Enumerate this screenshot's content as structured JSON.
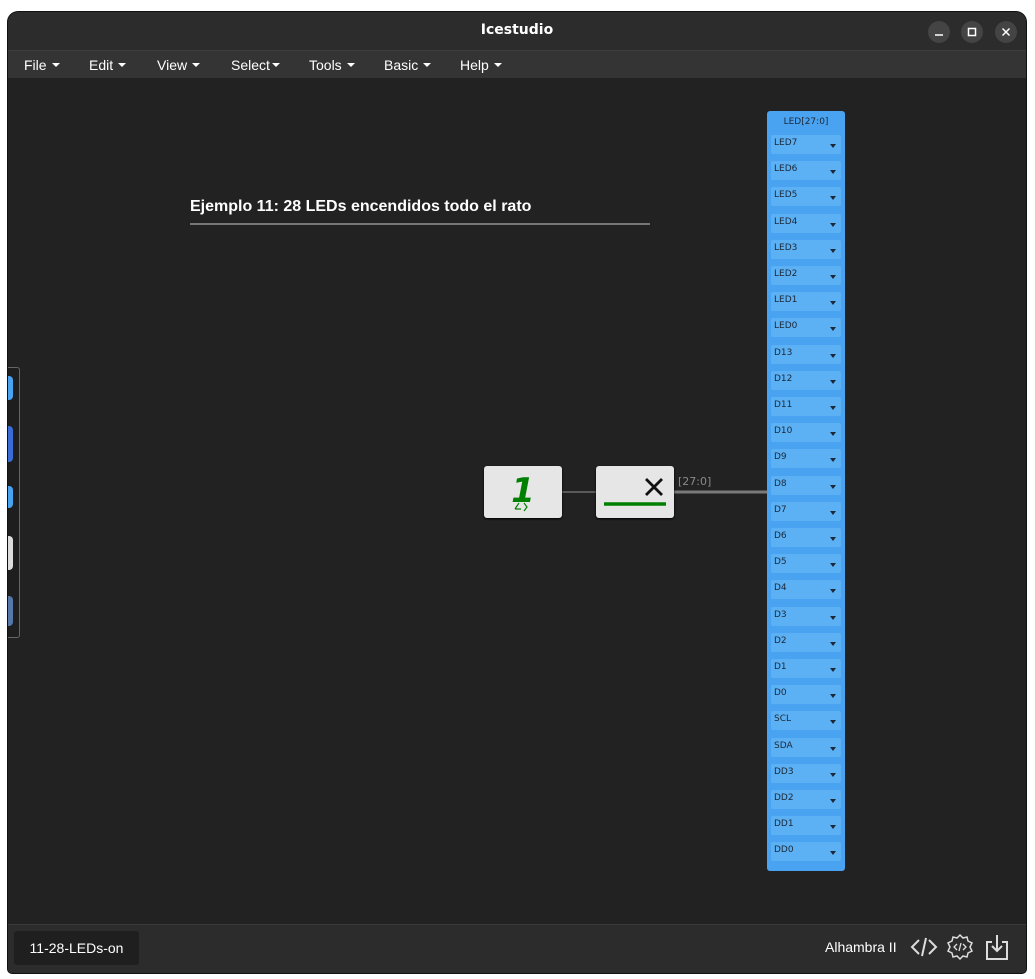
{
  "window": {
    "title": "Icestudio",
    "minimize_icon": "minimize-icon",
    "maximize_icon": "maximize-icon",
    "close_icon": "close-icon"
  },
  "menu": {
    "file": "File",
    "edit": "Edit",
    "view": "View",
    "select": "Select",
    "tools": "Tools",
    "basic": "Basic",
    "help": "Help"
  },
  "canvas": {
    "info_title": "Ejemplo 11: 28 LEDs encendidos todo el rato",
    "constant_value": "1",
    "bus_label": "[27:0]",
    "output": {
      "name": "LED[27:0]",
      "pins": [
        "LED7",
        "LED6",
        "LED5",
        "LED4",
        "LED3",
        "LED2",
        "LED1",
        "LED0",
        "D13",
        "D12",
        "D11",
        "D10",
        "D9",
        "D8",
        "D7",
        "D6",
        "D5",
        "D4",
        "D3",
        "D2",
        "D1",
        "D0",
        "SCL",
        "SDA",
        "DD3",
        "DD2",
        "DD1",
        "DD0"
      ]
    }
  },
  "footer": {
    "tab_label": "11-28-LEDs-on",
    "board": "Alhambra II",
    "icons": [
      "code-icon",
      "verify-icon",
      "upload-icon"
    ]
  },
  "colors": {
    "background": "#222222",
    "block_blue": "#4aa3f0",
    "pin_blue": "#5cb1f5",
    "green": "#008000"
  }
}
